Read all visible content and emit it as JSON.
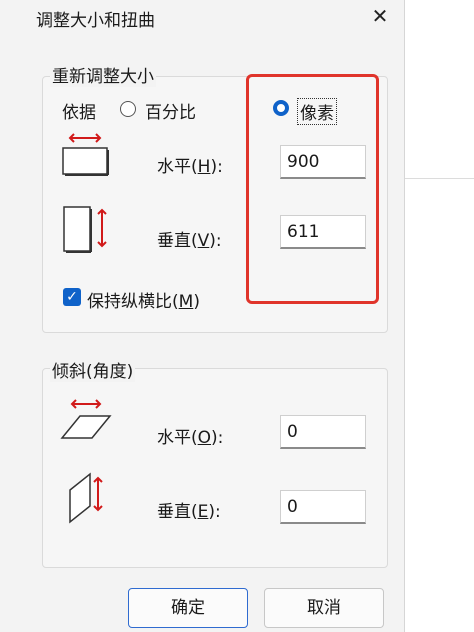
{
  "title": "调整大小和扭曲",
  "resize": {
    "group_title": "重新调整大小",
    "basis_label": "依据",
    "percent_label": "百分比",
    "pixels_label": "像素",
    "horizontal_label_pre": "水平(",
    "horizontal_key": "H",
    "horizontal_label_post": "):",
    "horizontal_value": "900",
    "vertical_label_pre": "垂直(",
    "vertical_key": "V",
    "vertical_label_post": "):",
    "vertical_value": "611",
    "keep_ratio_pre": "保持纵横比(",
    "keep_ratio_key": "M",
    "keep_ratio_post": ")"
  },
  "skew": {
    "group_title": "倾斜(角度)",
    "horizontal_label_pre": "水平(",
    "horizontal_key": "O",
    "horizontal_label_post": "):",
    "horizontal_value": "0",
    "vertical_label_pre": "垂直(",
    "vertical_key": "E",
    "vertical_label_post": "):",
    "vertical_value": "0"
  },
  "buttons": {
    "ok": "确定",
    "cancel": "取消"
  },
  "colors": {
    "accent": "#0f62c9",
    "highlight_box": "#e0342b",
    "arrow": "#d11a1a"
  },
  "icons": {
    "close": "close-icon",
    "checkbox": "checkmark-icon"
  }
}
